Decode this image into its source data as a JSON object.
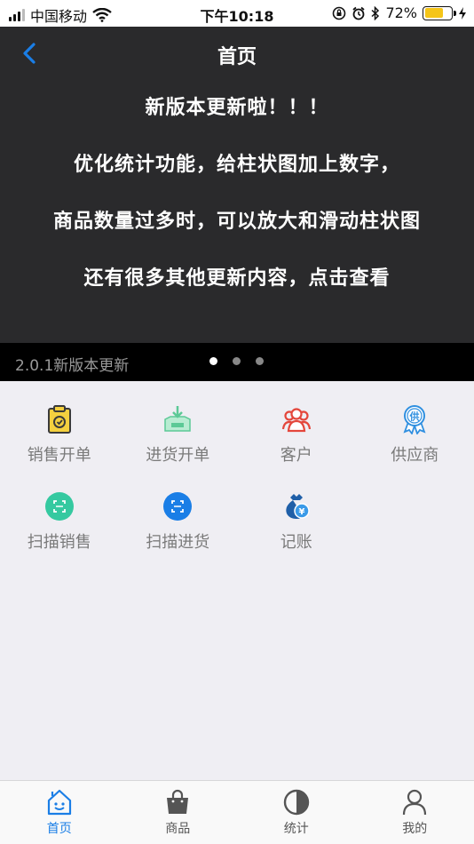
{
  "status_bar": {
    "carrier": "中国移动",
    "time": "下午10:18",
    "battery_percent": "72%",
    "battery_level": 0.72
  },
  "nav": {
    "title": "首页"
  },
  "banner": {
    "lines": [
      "新版本更新啦！！！",
      "优化统计功能，给柱状图加上数字，",
      "商品数量过多时，可以放大和滑动柱状图",
      "还有很多其他更新内容，点击查看"
    ],
    "caption": "2.0.1新版本更新",
    "page_count": 3,
    "active_page": 0
  },
  "grid": {
    "row1": [
      {
        "label": "销售开单",
        "icon": "sales-order-icon"
      },
      {
        "label": "进货开单",
        "icon": "purchase-order-icon"
      },
      {
        "label": "客户",
        "icon": "customer-icon"
      },
      {
        "label": "供应商",
        "icon": "supplier-icon"
      }
    ],
    "row2": [
      {
        "label": "扫描销售",
        "icon": "scan-sales-icon"
      },
      {
        "label": "扫描进货",
        "icon": "scan-purchase-icon"
      },
      {
        "label": "记账",
        "icon": "bookkeeping-icon"
      }
    ]
  },
  "tabs": [
    {
      "label": "首页",
      "icon": "home-icon",
      "active": true
    },
    {
      "label": "商品",
      "icon": "shopping-bag-icon",
      "active": false
    },
    {
      "label": "统计",
      "icon": "pie-chart-icon",
      "active": false
    },
    {
      "label": "我的",
      "icon": "profile-icon",
      "active": false
    }
  ],
  "colors": {
    "accent": "#1a7ee6",
    "banner_bg": "#2a2a2c",
    "battery": "#f5c518"
  }
}
